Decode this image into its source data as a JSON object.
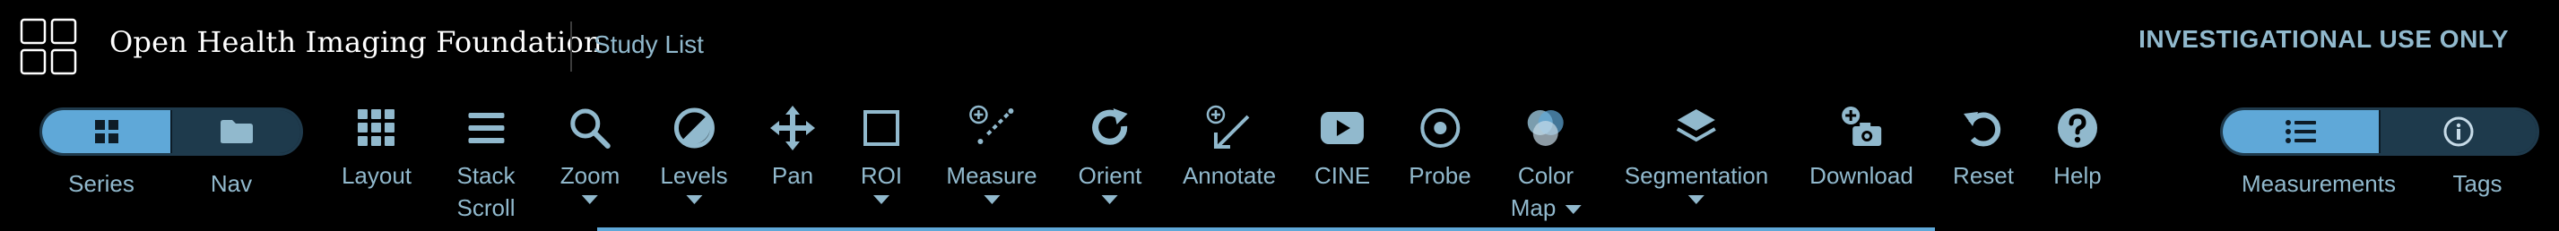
{
  "header": {
    "brand": "Open Health Imaging Foundation",
    "study_list": "Study List",
    "banner": "INVESTIGATIONAL USE ONLY"
  },
  "left_toggle": {
    "series": "Series",
    "nav": "Nav"
  },
  "right_toggle": {
    "measurements": "Measurements",
    "tags": "Tags"
  },
  "tools": {
    "layout": "Layout",
    "stack_1": "Stack",
    "stack_2": "Scroll",
    "zoom": "Zoom",
    "levels": "Levels",
    "pan": "Pan",
    "roi": "ROI",
    "measure": "Measure",
    "orient": "Orient",
    "annotate": "Annotate",
    "cine": "CINE",
    "probe": "Probe",
    "color_1": "Color",
    "color_2": "Map",
    "segmentation": "Segmentation",
    "download": "Download",
    "reset": "Reset",
    "help": "Help"
  },
  "colors": {
    "accent": "#5fa8d8",
    "text": "#91b9cd",
    "background": "#000000"
  }
}
